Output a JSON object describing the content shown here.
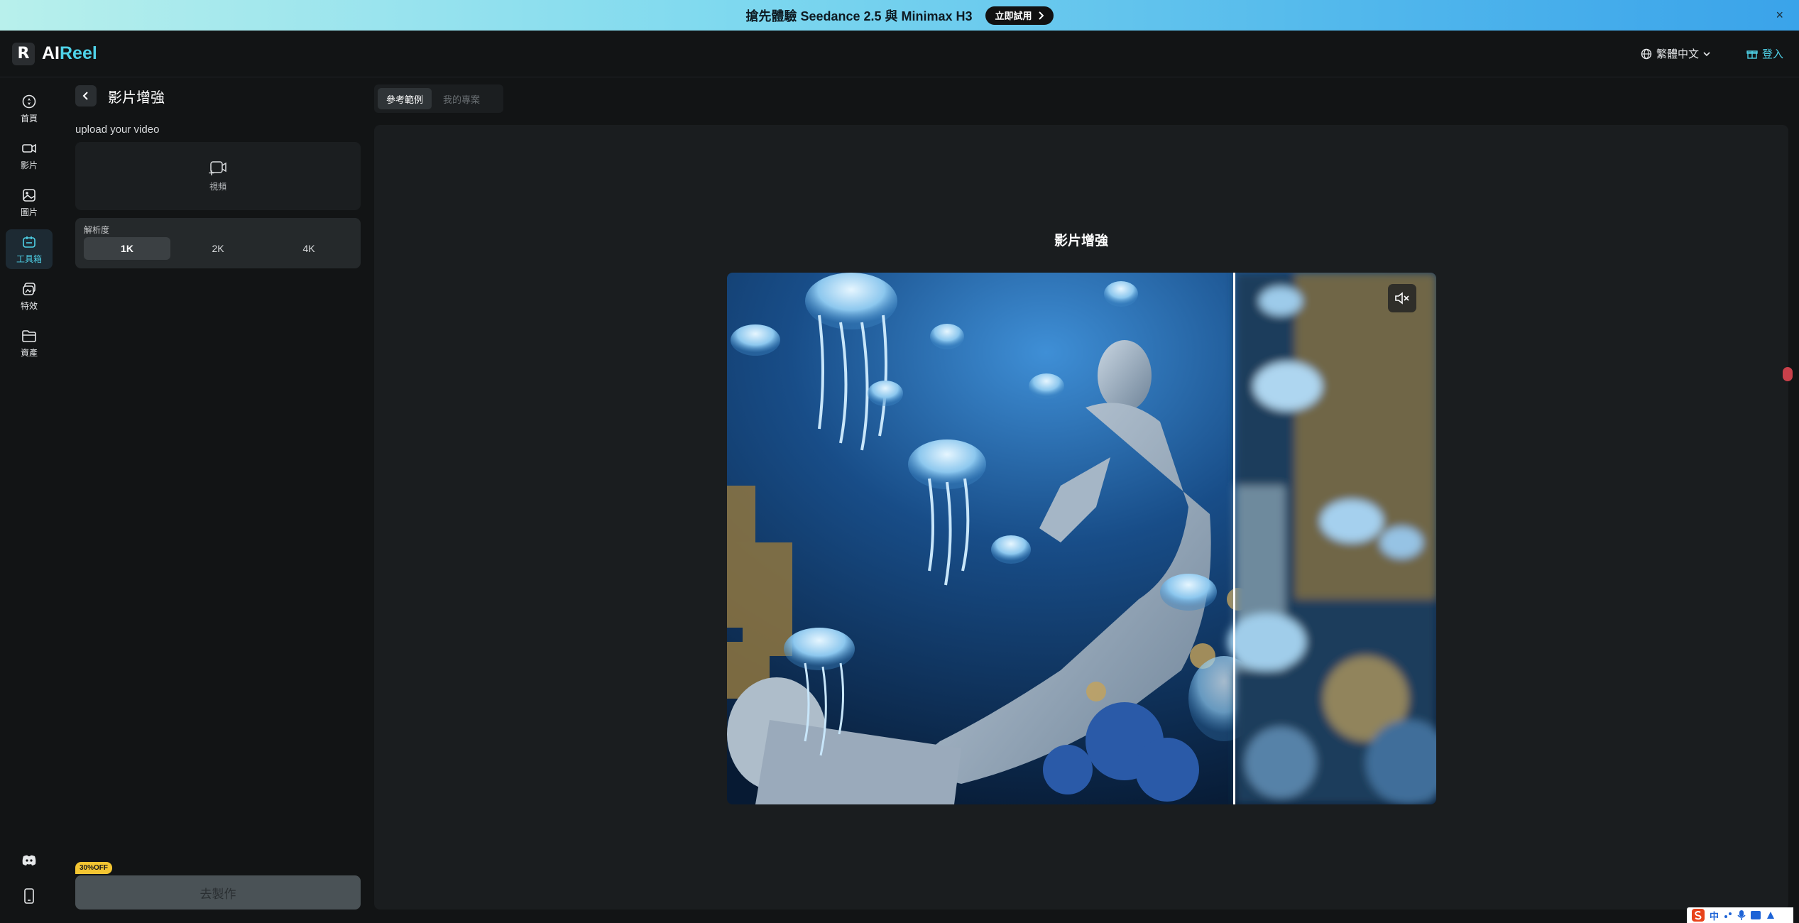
{
  "banner": {
    "text": "搶先體驗 Seedance 2.5 與 Minimax H3",
    "button": "立即試用",
    "close": "×"
  },
  "header": {
    "logo_prefix": "AI",
    "logo_suffix": "Reel",
    "language": "繁體中文",
    "login": "登入"
  },
  "rail": {
    "items": [
      {
        "label": "首頁",
        "icon": "home-icon"
      },
      {
        "label": "影片",
        "icon": "video-icon"
      },
      {
        "label": "圖片",
        "icon": "image-icon"
      },
      {
        "label": "工具箱",
        "icon": "toolbox-icon",
        "active": true
      },
      {
        "label": "特效",
        "icon": "effects-icon"
      },
      {
        "label": "資產",
        "icon": "folder-icon"
      }
    ],
    "bottom": [
      "discord-icon",
      "mobile-icon"
    ]
  },
  "panel": {
    "title": "影片增強",
    "upload_label": "upload your video",
    "upload_button": "視頻",
    "resolution_label": "解析度",
    "resolutions": [
      "1K",
      "2K",
      "4K"
    ],
    "selected_resolution": "1K",
    "discount": "30%OFF",
    "go_button": "去製作"
  },
  "main": {
    "tabs": [
      "參考範例",
      "我的專案"
    ],
    "selected_tab": "參考範例",
    "stage_title": "影片增強",
    "mute_icon": "volume-mute-icon"
  },
  "ime": {
    "label": "中"
  },
  "colors": {
    "accent": "#4fd2e8",
    "banner_start": "#b8f0ec",
    "banner_end": "#3aa3ea",
    "discount": "#f3c532"
  }
}
